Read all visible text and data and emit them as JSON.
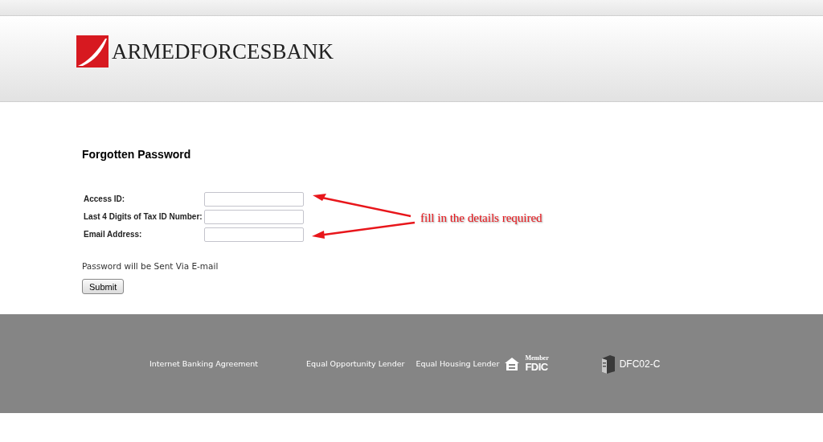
{
  "header": {
    "logo_text": "ARMEDFORCESBANK"
  },
  "form": {
    "title": "Forgotten Password",
    "fields": [
      {
        "label": "Access ID:"
      },
      {
        "label": "Last 4 Digits of Tax ID Number:"
      },
      {
        "label": "Email Address:"
      }
    ],
    "note": "Password will be Sent Via E-mail",
    "submit": "Submit"
  },
  "annotation": {
    "text": "fill in the details required"
  },
  "footer": {
    "links": [
      "Internet Banking Agreement",
      "Equal Opportunity Lender",
      "Equal Housing Lender"
    ],
    "fdic_member": "Member",
    "fdic": "FDIC",
    "code": "DFC02-C"
  }
}
